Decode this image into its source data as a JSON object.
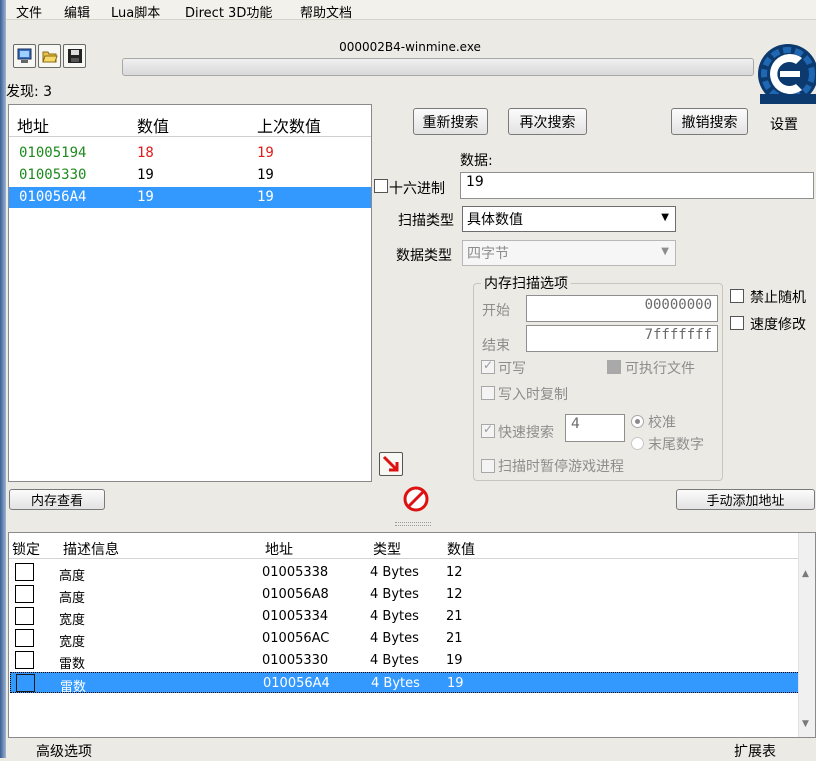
{
  "menu": [
    "文件",
    "编辑",
    "Lua脚本",
    "Direct 3D功能",
    "帮助文档"
  ],
  "toolbar": {
    "process_title": "000002B4-winmine.exe",
    "settings_label": "设置"
  },
  "found": {
    "label": "发现: 3"
  },
  "results": {
    "headers": [
      "地址",
      "数值",
      "上次数值"
    ],
    "rows": [
      {
        "address": "01005194",
        "value": "18",
        "previous": "19"
      },
      {
        "address": "01005330",
        "value": "19",
        "previous": "19"
      },
      {
        "address": "010056A4",
        "value": "19",
        "previous": "19"
      }
    ],
    "colors": {
      "address_green": "#1e8a1e",
      "changed_red": "#e01a1a",
      "selection": "#3399ff"
    }
  },
  "scan": {
    "new_scan": "重新搜索",
    "next_scan": "再次搜索",
    "undo_scan": "撤销搜索",
    "value_label": "数据:",
    "hex_label": "十六进制",
    "value": "19",
    "scan_type_label": "扫描类型",
    "scan_type_value": "具体数值",
    "value_type_label": "数据类型",
    "value_type_value": "四字节"
  },
  "memory_options": {
    "title": "内存扫描选项",
    "start_label": "开始",
    "start_value": "00000000",
    "stop_label": "结束",
    "stop_value": "7fffffff",
    "writable": "可写",
    "executable": "可执行文件",
    "copy_on_write": "写入时复制",
    "fast_scan": "快速搜索",
    "fast_scan_value": "4",
    "alignment": "校准",
    "last_digits": "末尾数字",
    "pause_game": "扫描时暂停游戏进程"
  },
  "side_options": {
    "disable_random": "禁止随机",
    "speedhack": "速度修改"
  },
  "buttons": {
    "memory_view": "内存查看",
    "add_address": "手动添加地址"
  },
  "address_list": {
    "headers": [
      "锁定",
      "描述信息",
      "地址",
      "类型",
      "数值"
    ],
    "rows": [
      {
        "desc": "高度",
        "address": "01005338",
        "type": "4 Bytes",
        "value": "12"
      },
      {
        "desc": "高度",
        "address": "010056A8",
        "type": "4 Bytes",
        "value": "12"
      },
      {
        "desc": "宽度",
        "address": "01005334",
        "type": "4 Bytes",
        "value": "21"
      },
      {
        "desc": "宽度",
        "address": "010056AC",
        "type": "4 Bytes",
        "value": "21"
      },
      {
        "desc": "雷数",
        "address": "01005330",
        "type": "4 Bytes",
        "value": "19"
      },
      {
        "desc": "雷数",
        "address": "010056A4",
        "type": "4 Bytes",
        "value": "19"
      }
    ]
  },
  "statusbar": {
    "advanced": "高级选项",
    "extras": "扩展表"
  }
}
